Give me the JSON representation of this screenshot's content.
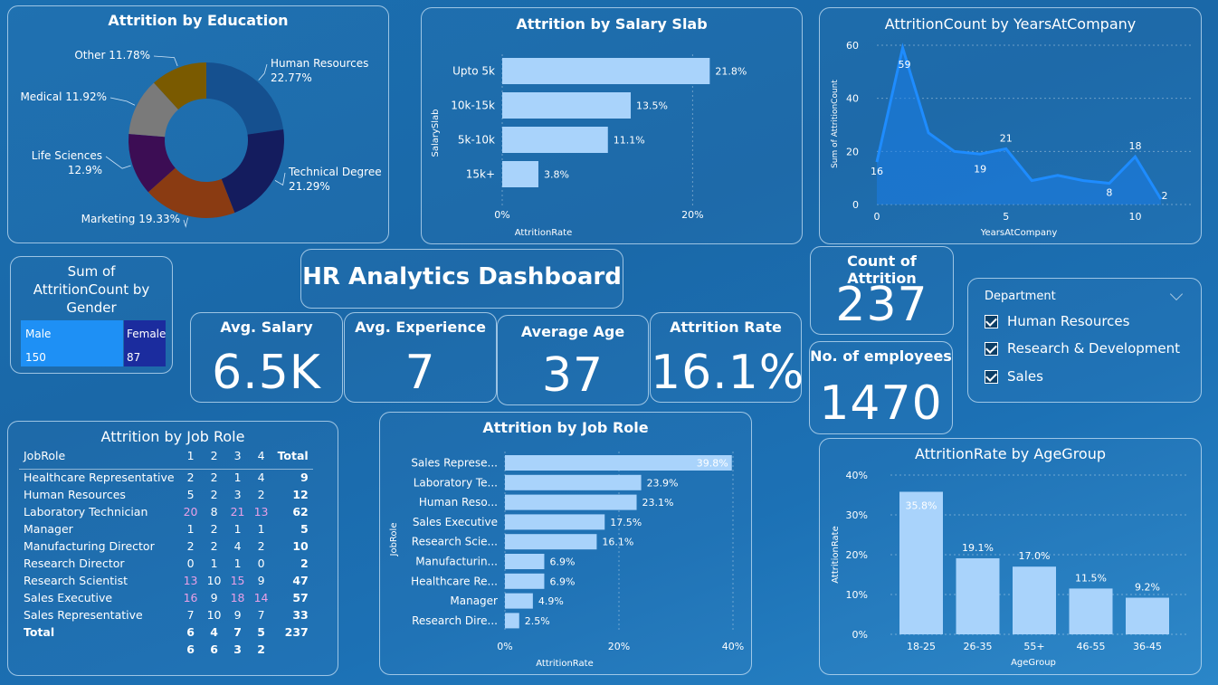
{
  "dashboard_title": "HR Analytics Dashboard",
  "kpis": {
    "avg_salary": {
      "label": "Avg. Salary",
      "value": "6.5K"
    },
    "avg_experience": {
      "label": "Avg. Experience",
      "value": "7"
    },
    "average_age": {
      "label": "Average Age",
      "value": "37"
    },
    "attrition_rate": {
      "label": "Attrition Rate",
      "value": "16.1%"
    },
    "count_attrition": {
      "label": "Count of Attrition",
      "value": "237"
    },
    "employees": {
      "label": "No. of employees",
      "value": "1470"
    }
  },
  "gender": {
    "title": "Sum of AttritionCount by Gender",
    "male_label": "Male",
    "male_value": "150",
    "female_label": "Female",
    "female_value": "87",
    "colors": {
      "male": "#1e90f5",
      "female": "#1b2c9e"
    }
  },
  "department": {
    "title": "Department",
    "items": [
      "Human Resources",
      "Research & Development",
      "Sales"
    ]
  },
  "job_matrix": {
    "title": "Attrition by Job Role",
    "headers": [
      "JobRole",
      "1",
      "2",
      "3",
      "4",
      "Total"
    ],
    "rows": [
      {
        "role": "Healthcare Representative",
        "v": [
          "2",
          "2",
          "1",
          "4"
        ],
        "total": "9"
      },
      {
        "role": "Human Resources",
        "v": [
          "5",
          "2",
          "3",
          "2"
        ],
        "total": "12"
      },
      {
        "role": "Laboratory Technician",
        "v": [
          "20",
          "8",
          "21",
          "13"
        ],
        "total": "62"
      },
      {
        "role": "Manager",
        "v": [
          "1",
          "2",
          "1",
          "1"
        ],
        "total": "5"
      },
      {
        "role": "Manufacturing Director",
        "v": [
          "2",
          "2",
          "4",
          "2"
        ],
        "total": "10"
      },
      {
        "role": "Research Director",
        "v": [
          "0",
          "1",
          "1",
          "0"
        ],
        "total": "2"
      },
      {
        "role": "Research Scientist",
        "v": [
          "13",
          "10",
          "15",
          "9"
        ],
        "total": "47"
      },
      {
        "role": "Sales Executive",
        "v": [
          "16",
          "9",
          "18",
          "14"
        ],
        "total": "57"
      },
      {
        "role": "Sales Representative",
        "v": [
          "7",
          "10",
          "9",
          "7"
        ],
        "total": "33"
      }
    ],
    "total_label": "Total",
    "total_row1": [
      "6",
      "4",
      "7",
      "5"
    ],
    "total_value": "237",
    "total_row2": [
      "6",
      "6",
      "3",
      "2"
    ]
  },
  "chart_data": [
    {
      "id": "education",
      "type": "pie",
      "title": "Attrition by Education",
      "slices": [
        {
          "label": "Human Resources",
          "value": 22.77,
          "text": "22.77%",
          "color": "#15508f"
        },
        {
          "label": "Technical Degree",
          "value": 21.29,
          "text": "21.29%",
          "color": "#141c5e"
        },
        {
          "label": "Marketing",
          "value": 19.33,
          "text": "19.33%",
          "color": "#8a3b12"
        },
        {
          "label": "Life Sciences",
          "value": 12.9,
          "text": "12.9%",
          "color": "#3c0d54"
        },
        {
          "label": "Medical",
          "value": 11.92,
          "text": "11.92%",
          "color": "#7a7a7a"
        },
        {
          "label": "Other",
          "value": 11.78,
          "text": "11.78%",
          "color": "#7a5a00"
        }
      ]
    },
    {
      "id": "salary",
      "type": "bar",
      "title": "Attrition by Salary Slab",
      "orientation": "horizontal",
      "categories": [
        "Upto 5k",
        "10k-15k",
        "5k-10k",
        "15k+"
      ],
      "values": [
        21.8,
        13.5,
        11.1,
        3.8
      ],
      "labels": [
        "21.8%",
        "13.5%",
        "11.1%",
        "3.8%"
      ],
      "xlabel": "AttritionRate",
      "ylabel": "SalarySlab",
      "xlim": [
        0,
        25
      ],
      "ticks": [
        0,
        20
      ],
      "tick_labels": [
        "0%",
        "20%"
      ]
    },
    {
      "id": "years",
      "type": "area",
      "title": "AttritionCount by YearsAtCompany",
      "x": [
        0,
        1,
        2,
        3,
        4,
        5,
        6,
        7,
        8,
        9,
        10,
        11
      ],
      "y": [
        16,
        59,
        27,
        20,
        19,
        21,
        9,
        11,
        9,
        8,
        18,
        2
      ],
      "point_labels": [
        {
          "i": 0,
          "text": "16"
        },
        {
          "i": 1,
          "text": "59"
        },
        {
          "i": 4,
          "text": "19"
        },
        {
          "i": 5,
          "text": "21"
        },
        {
          "i": 9,
          "text": "8"
        },
        {
          "i": 10,
          "text": "18"
        },
        {
          "i": 11,
          "text": "2"
        }
      ],
      "xlabel": "YearsAtCompany",
      "ylabel": "Sum of AttritionCount",
      "ylim": [
        0,
        60
      ],
      "yticks": [
        0,
        20,
        40,
        60
      ],
      "xlim": [
        0,
        11
      ],
      "xticks": [
        0,
        5,
        10
      ]
    },
    {
      "id": "jobrole",
      "type": "bar",
      "title": "Attrition by Job Role",
      "orientation": "horizontal",
      "categories": [
        "Sales Represe...",
        "Laboratory Te...",
        "Human Reso...",
        "Sales Executive",
        "Research Scie...",
        "Manufacturin...",
        "Healthcare Re...",
        "Manager",
        "Research Dire..."
      ],
      "values": [
        39.8,
        23.9,
        23.1,
        17.5,
        16.1,
        6.9,
        6.9,
        4.9,
        2.5
      ],
      "labels": [
        "39.8%",
        "23.9%",
        "23.1%",
        "17.5%",
        "16.1%",
        "6.9%",
        "6.9%",
        "4.9%",
        "2.5%"
      ],
      "xlabel": "AttritionRate",
      "ylabel": "JobRole",
      "xlim": [
        0,
        40
      ],
      "ticks": [
        0,
        20,
        40
      ],
      "tick_labels": [
        "0%",
        "20%",
        "40%"
      ]
    },
    {
      "id": "agegroup",
      "type": "bar",
      "title": "AttritionRate by AgeGroup",
      "categories": [
        "18-25",
        "26-35",
        "55+",
        "46-55",
        "36-45"
      ],
      "values": [
        35.8,
        19.1,
        17.0,
        11.5,
        9.2
      ],
      "labels": [
        "35.8%",
        "19.1%",
        "17.0%",
        "11.5%",
        "9.2%"
      ],
      "xlabel": "AgeGroup",
      "ylabel": "AttritionRate",
      "ylim": [
        0,
        40
      ],
      "yticks": [
        0,
        10,
        20,
        30,
        40
      ],
      "tick_labels": [
        "0%",
        "10%",
        "20%",
        "30%",
        "40%"
      ]
    }
  ],
  "colors": {
    "bar": "#a9d3fb",
    "line": "#1e8cff",
    "area": "#1a7ee8"
  }
}
